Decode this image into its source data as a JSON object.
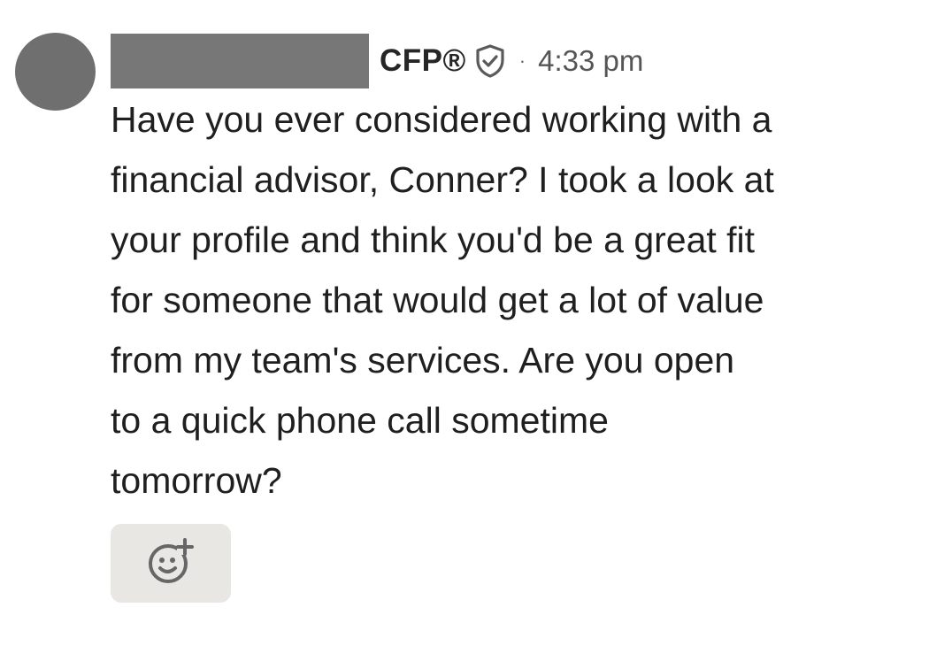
{
  "header": {
    "credential": "CFP®",
    "separator": "·",
    "timestamp": "4:33 pm"
  },
  "message": {
    "lines": [
      "Have you ever considered working with a",
      "financial advisor, Conner? I took a look at",
      "your profile and think you'd be a great fit",
      "for someone that would get a lot of value",
      "from my team's services. Are you open",
      "to a quick phone call sometime",
      "tomorrow?"
    ]
  },
  "icons": {
    "verified": "shield-check-icon",
    "reaction": "add-reaction-icon"
  },
  "colors": {
    "avatar": "#6f6f6f",
    "redaction": "#777777",
    "reaction_button_bg": "#e9e7e3"
  }
}
